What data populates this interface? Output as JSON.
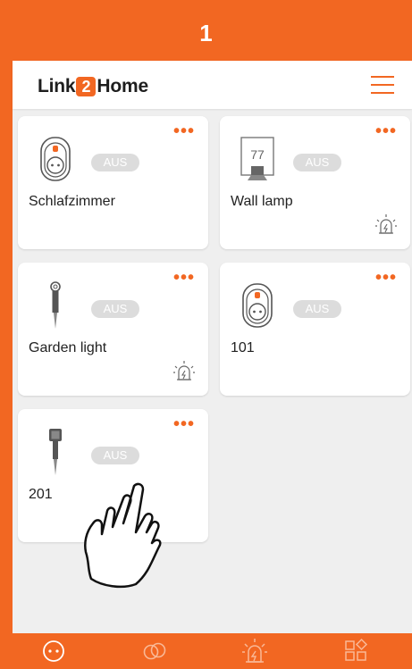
{
  "step_label": "1",
  "brand": {
    "part1": "Link",
    "part2": "2",
    "part3": "Home"
  },
  "colors": {
    "accent": "#F26722",
    "card": "#FFFFFF",
    "badge": "#DCDCDC",
    "background": "#EFEFEF"
  },
  "devices": [
    {
      "name": "Schlafzimmer",
      "state": "AUS",
      "icon": "plug-icon",
      "alarm": false,
      "menu": "•••"
    },
    {
      "name": "Wall lamp",
      "state": "AUS",
      "icon": "wall-lamp-icon",
      "icon_text": "77",
      "alarm": true,
      "menu": "•••"
    },
    {
      "name": "Garden light",
      "state": "AUS",
      "icon": "garden-light-icon",
      "alarm": true,
      "menu": "•••"
    },
    {
      "name": "101",
      "state": "AUS",
      "icon": "plug-icon",
      "alarm": false,
      "menu": "•••"
    },
    {
      "name": "201",
      "state": "AUS",
      "icon": "spike-light-icon",
      "alarm": false,
      "menu": "•••"
    }
  ],
  "tabs": [
    "devices-tab-icon",
    "groups-tab-icon",
    "alarm-tab-icon",
    "scenes-tab-icon"
  ]
}
